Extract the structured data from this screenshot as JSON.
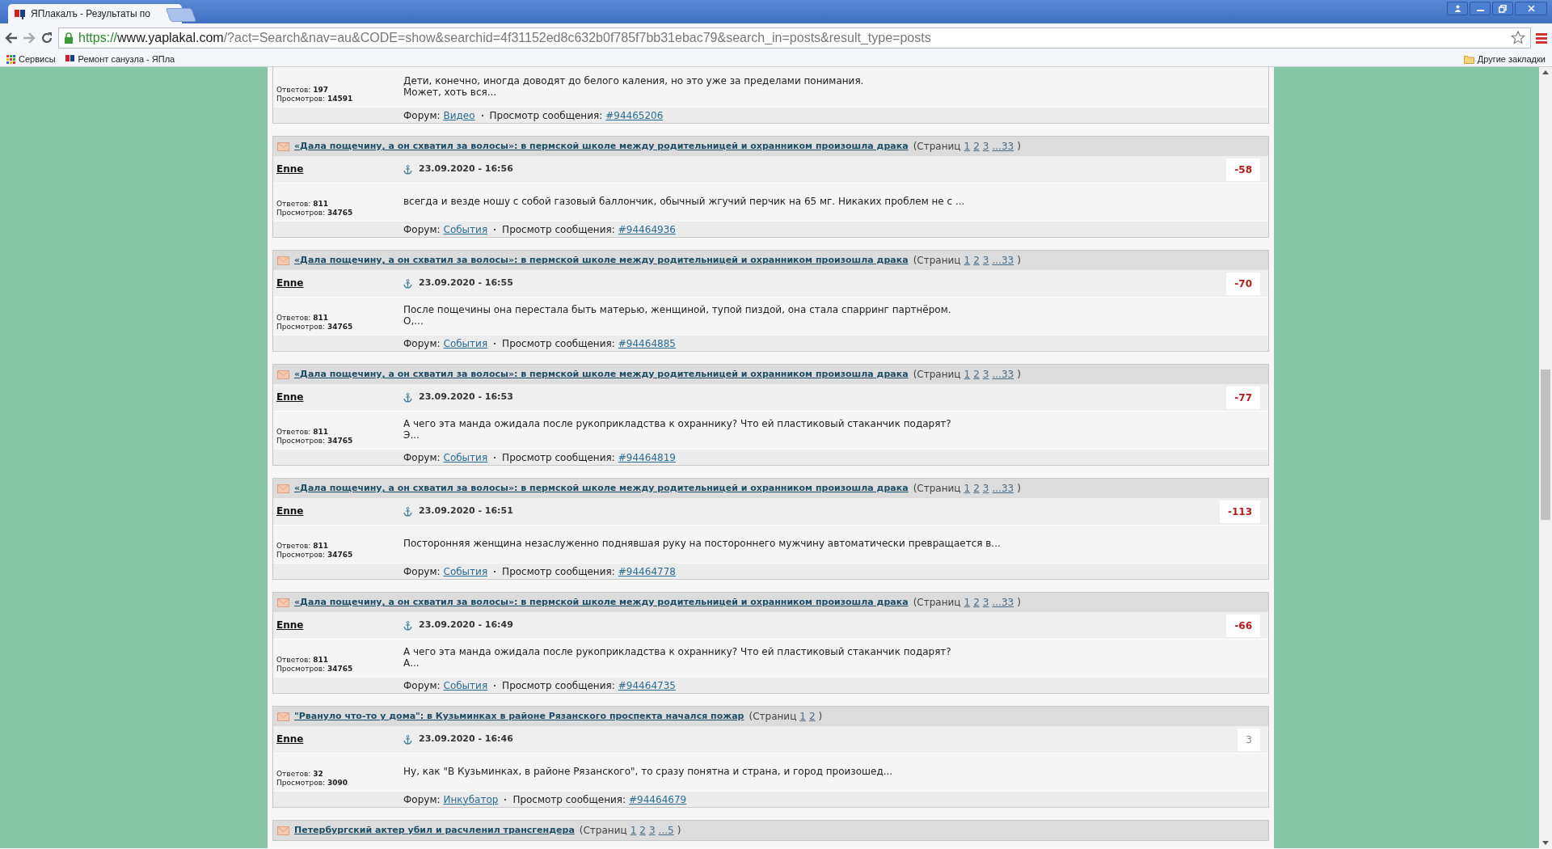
{
  "browser": {
    "tab_title": "ЯПлакалъ - Результаты по",
    "url_scheme": "https://",
    "url_host": "www.yaplakal.com",
    "url_rest": "/?act=Search&nav=au&CODE=show&searchid=4f31152ed8c632b0f785f7bb31ebac79&search_in=posts&result_type=posts",
    "bookmarks": [
      "Сервисы",
      "Ремонт санузла - ЯПла"
    ],
    "other_bookmarks": "Другие закладки"
  },
  "posts": [
    {
      "kind": "partial",
      "replies": "Ответов: **197**",
      "views": "Просмотров: **14591**",
      "body": [
        "Дети, конечно, иногда доводят до белого каления, но это уже за пределами понимания.",
        "Может, хоть вся..."
      ],
      "forum_label": "Форум:",
      "forum": "Видео",
      "message_label": "Просмотр сообщения:",
      "message_id": "#94465206"
    },
    {
      "kind": "full",
      "title": "«Дала пощечину, а он схватил за волосы»: в пермской школе между родительницей и охранником произошла драка",
      "pages_label": "(Страниц",
      "pages": [
        "1",
        "2",
        "3",
        "...33"
      ],
      "pages_close": ")",
      "author": "Enne",
      "date": "23.09.2020 - 16:56",
      "score": "-58",
      "negative": true,
      "replies": "Ответов: **811**",
      "views": "Просмотров: **34765**",
      "body": [
        "всегда и везде ношу с собой газовый баллончик, обычный жгучий перчик на 65 мг. Никаких проблем не с ..."
      ],
      "forum_label": "Форум:",
      "forum": "События",
      "message_label": "Просмотр сообщения:",
      "message_id": "#94464936"
    },
    {
      "kind": "full",
      "title": "«Дала пощечину, а он схватил за волосы»: в пермской школе между родительницей и охранником произошла драка",
      "pages_label": "(Страниц",
      "pages": [
        "1",
        "2",
        "3",
        "...33"
      ],
      "pages_close": ")",
      "author": "Enne",
      "date": "23.09.2020 - 16:55",
      "score": "-70",
      "negative": true,
      "replies": "Ответов: **811**",
      "views": "Просмотров: **34765**",
      "body": [
        "После пощечины она перестала быть матерью, женщиной, тупой пиздой, она стала спарринг партнёром.",
        "О,..."
      ],
      "forum_label": "Форум:",
      "forum": "События",
      "message_label": "Просмотр сообщения:",
      "message_id": "#94464885"
    },
    {
      "kind": "full",
      "title": "«Дала пощечину, а он схватил за волосы»: в пермской школе между родительницей и охранником произошла драка",
      "pages_label": "(Страниц",
      "pages": [
        "1",
        "2",
        "3",
        "...33"
      ],
      "pages_close": ")",
      "author": "Enne",
      "date": "23.09.2020 - 16:53",
      "score": "-77",
      "negative": true,
      "replies": "Ответов: **811**",
      "views": "Просмотров: **34765**",
      "body": [
        "А чего эта манда ожидала после рукоприкладства к охраннику? Что ей пластиковый стаканчик подарят?",
        "Э..."
      ],
      "forum_label": "Форум:",
      "forum": "События",
      "message_label": "Просмотр сообщения:",
      "message_id": "#94464819"
    },
    {
      "kind": "full",
      "title": "«Дала пощечину, а он схватил за волосы»: в пермской школе между родительницей и охранником произошла драка",
      "pages_label": "(Страниц",
      "pages": [
        "1",
        "2",
        "3",
        "...33"
      ],
      "pages_close": ")",
      "author": "Enne",
      "date": "23.09.2020 - 16:51",
      "score": "-113",
      "negative": true,
      "replies": "Ответов: **811**",
      "views": "Просмотров: **34765**",
      "body": [
        "Посторонняя женщина незаслуженно поднявшая руку на постороннего мужчину автоматически превращается в..."
      ],
      "forum_label": "Форум:",
      "forum": "События",
      "message_label": "Просмотр сообщения:",
      "message_id": "#94464778"
    },
    {
      "kind": "full",
      "title": "«Дала пощечину, а он схватил за волосы»: в пермской школе между родительницей и охранником произошла драка",
      "pages_label": "(Страниц",
      "pages": [
        "1",
        "2",
        "3",
        "...33"
      ],
      "pages_close": ")",
      "author": "Enne",
      "date": "23.09.2020 - 16:49",
      "score": "-66",
      "negative": true,
      "replies": "Ответов: **811**",
      "views": "Просмотров: **34765**",
      "body": [
        "А чего эта манда ожидала после рукоприкладства к охраннику? Что ей пластиковый стаканчик подарят?",
        "А..."
      ],
      "forum_label": "Форум:",
      "forum": "События",
      "message_label": "Просмотр сообщения:",
      "message_id": "#94464735"
    },
    {
      "kind": "full",
      "title": "\"Рвануло что-то у дома\": в Кузьминках в районе Рязанского проспекта начался пожар",
      "pages_label": "(Страниц",
      "pages": [
        "1",
        "2"
      ],
      "pages_close": ")",
      "author": "Enne",
      "date": "23.09.2020 - 16:46",
      "score": "3",
      "negative": false,
      "replies": "Ответов: **32**",
      "views": "Просмотров: **3090**",
      "body": [
        "Ну, как \"В Кузьминках, в районе Рязанского\", то сразу понятна и страна, и город произошед..."
      ],
      "forum_label": "Форум:",
      "forum": "Инкубатор",
      "message_label": "Просмотр сообщения:",
      "message_id": "#94464679"
    },
    {
      "kind": "header",
      "title": "Петербургский актер убил и расчленил трансгендера",
      "pages_label": "(Страниц",
      "pages": [
        "1",
        "2",
        "3",
        "...5"
      ],
      "pages_close": ")"
    }
  ]
}
